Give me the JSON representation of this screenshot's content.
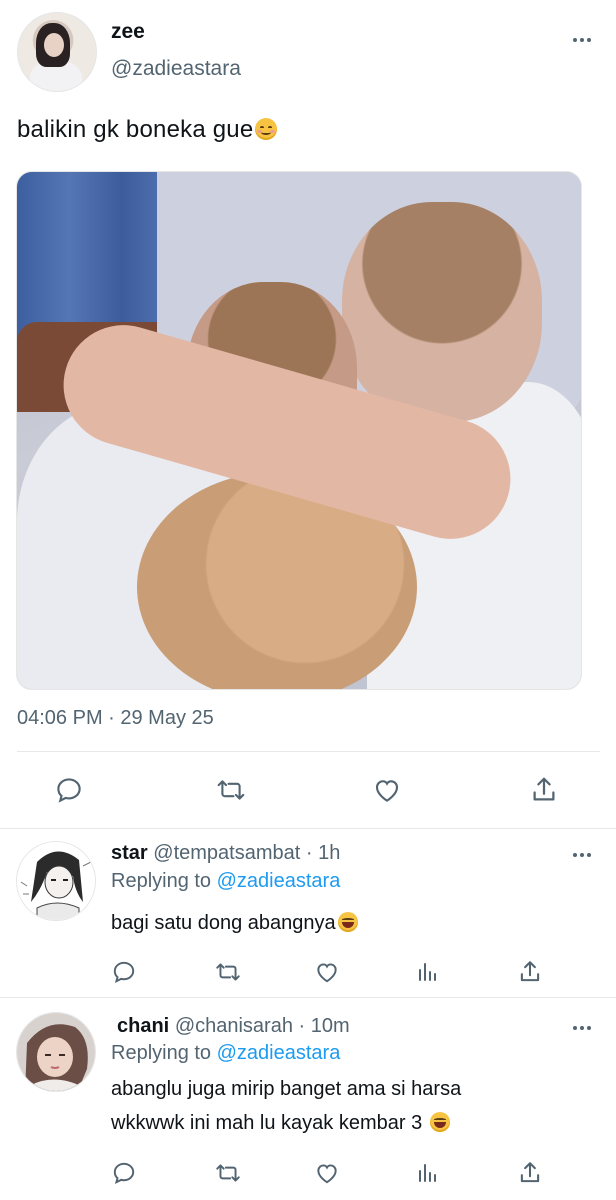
{
  "tweet": {
    "display_name": "zee",
    "handle": "@zadieastara",
    "text": "balikin gk boneka gue",
    "timestamp": "04:06 PM · 29 May 25"
  },
  "replies": [
    {
      "name": "star",
      "handle_time": "@tempatsambat · 1h",
      "replying_label": "Replying to ",
      "replying_to": "@zadieastara",
      "text": "bagi satu dong abangnya"
    },
    {
      "name": "chani",
      "handle_time": "@chanisarah · 10m",
      "replying_label": "Replying to ",
      "replying_to": "@zadieastara",
      "text_line1": "abanglu juga mirip banget ama si harsa",
      "text_line2": "wkkwwk ini mah lu kayak kembar 3"
    }
  ],
  "colors": {
    "text": "#0f1419",
    "secondary": "#536471",
    "link": "#1d9bf0",
    "divider": "#e6e9ec"
  },
  "icons": [
    "more-icon",
    "reply-icon",
    "retweet-icon",
    "like-icon",
    "share-icon",
    "analytics-icon"
  ]
}
